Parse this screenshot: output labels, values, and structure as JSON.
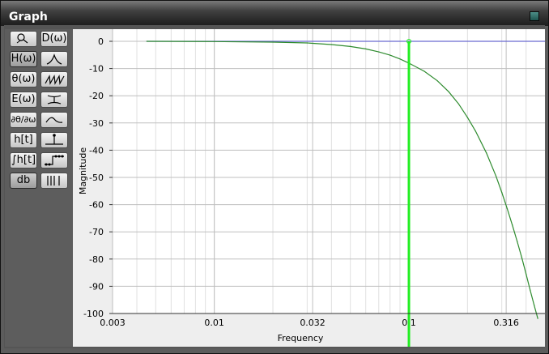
{
  "window": {
    "title": "Graph"
  },
  "toolbar": {
    "buttons": [
      {
        "id": "zoom",
        "label": "",
        "icon": "zoom-icon"
      },
      {
        "id": "group-delay",
        "label": "D(ω)",
        "icon": ""
      },
      {
        "id": "magnitude",
        "label": "H(ω)",
        "icon": "",
        "active": true
      },
      {
        "id": "peak",
        "label": "",
        "icon": "peak-icon"
      },
      {
        "id": "phase",
        "label": "θ(ω)",
        "icon": ""
      },
      {
        "id": "sawtooth",
        "label": "",
        "icon": "sawtooth-icon"
      },
      {
        "id": "error",
        "label": "E(ω)",
        "icon": ""
      },
      {
        "id": "ibeam",
        "label": "",
        "icon": "i-beam-icon"
      },
      {
        "id": "phase-derivative",
        "label": "∂θ/∂ω",
        "icon": ""
      },
      {
        "id": "wave",
        "label": "",
        "icon": "wave-icon"
      },
      {
        "id": "impulse",
        "label": "h[t]",
        "icon": ""
      },
      {
        "id": "impulse-marker",
        "label": "",
        "icon": "impulse-icon"
      },
      {
        "id": "step",
        "label": "∫h[t]",
        "icon": ""
      },
      {
        "id": "step-marker",
        "label": "",
        "icon": "step-icon"
      },
      {
        "id": "db",
        "label": "db",
        "icon": "",
        "active": true
      },
      {
        "id": "bars",
        "label": "",
        "icon": "bars-icon"
      }
    ]
  },
  "colors": {
    "response": "#2e8b2e",
    "cursor": "#22ee22",
    "reference": "#6a6ad0",
    "grid_major": "#bfbfbf",
    "grid_minor": "#e0e0e0",
    "plot_bg": "#ffffff"
  },
  "chart_data": {
    "type": "line",
    "xlabel": "Frequency",
    "ylabel": "Magnitude",
    "x_scale": "log",
    "xlim": [
      0.003,
      0.5
    ],
    "ylim": [
      -100,
      0
    ],
    "x_ticks": [
      "0.003",
      "0.01",
      "0.032",
      "0.1",
      "0.316"
    ],
    "x_tick_values": [
      0.003,
      0.01,
      0.032,
      0.1,
      0.316
    ],
    "y_ticks": [
      0,
      -10,
      -20,
      -30,
      -40,
      -50,
      -60,
      -70,
      -80,
      -90,
      -100
    ],
    "grid": true,
    "cursor_x": 0.1,
    "series": [
      {
        "name": "",
        "role": "reference",
        "x": [
          0.0045,
          0.5
        ],
        "y": [
          0,
          0
        ]
      },
      {
        "name": "",
        "role": "response",
        "x": [
          0.0045,
          0.01,
          0.02,
          0.03,
          0.04,
          0.05,
          0.06,
          0.07,
          0.08,
          0.09,
          0.1,
          0.12,
          0.14,
          0.16,
          0.18,
          0.2,
          0.22,
          0.25,
          0.28,
          0.3,
          0.32,
          0.34,
          0.36,
          0.38,
          0.4,
          0.42,
          0.44,
          0.46
        ],
        "y": [
          0,
          -0.1,
          -0.3,
          -0.6,
          -1.2,
          -1.9,
          -2.8,
          -3.9,
          -5.1,
          -6.5,
          -8,
          -11,
          -14.5,
          -18.5,
          -23,
          -28,
          -33,
          -41,
          -49.5,
          -55.5,
          -61.5,
          -67.5,
          -73.5,
          -79.5,
          -85.5,
          -91.5,
          -97,
          -102
        ]
      }
    ]
  }
}
